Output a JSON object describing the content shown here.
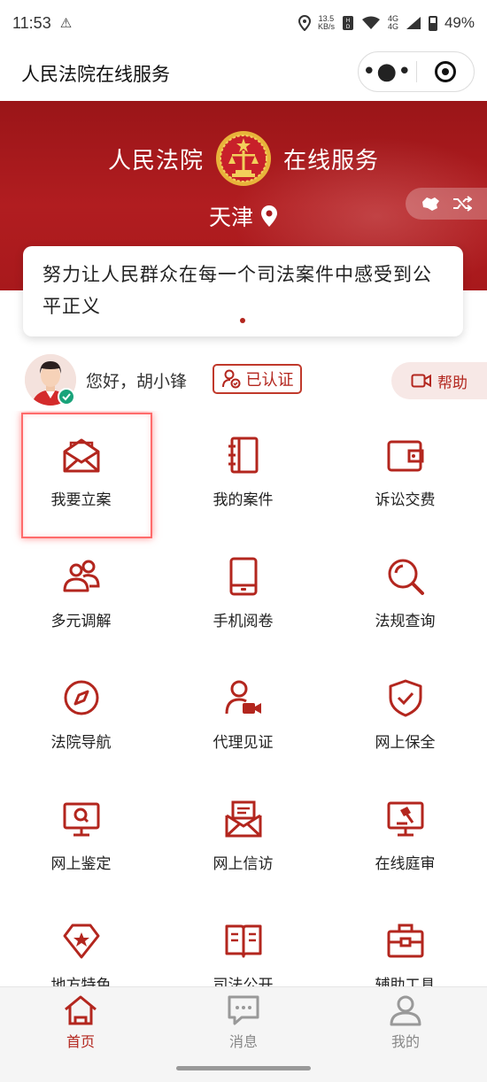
{
  "status_bar": {
    "time": "11:53",
    "net_speed_top": "13.5",
    "net_speed_unit": "KB/s",
    "network": "4G",
    "battery": "49%"
  },
  "title_bar": {
    "title": "人民法院在线服务"
  },
  "banner": {
    "left_text": "人民法院",
    "right_text": "在线服务",
    "city": "天津"
  },
  "slogan": {
    "text": "努力让人民群众在每一个司法案件中感受到公平正义"
  },
  "user": {
    "greeting": "您好，胡小锋",
    "verified_label": "已认证",
    "help_label": "帮助"
  },
  "grid": {
    "items": [
      {
        "label": "我要立案",
        "icon": "envelope-open-icon"
      },
      {
        "label": "我的案件",
        "icon": "notebook-icon"
      },
      {
        "label": "诉讼交费",
        "icon": "wallet-icon"
      },
      {
        "label": "多元调解",
        "icon": "people-icon"
      },
      {
        "label": "手机阅卷",
        "icon": "mobile-phone-icon"
      },
      {
        "label": "法规查询",
        "icon": "search-icon"
      },
      {
        "label": "法院导航",
        "icon": "compass-icon"
      },
      {
        "label": "代理见证",
        "icon": "user-video-icon"
      },
      {
        "label": "网上保全",
        "icon": "shield-check-icon"
      },
      {
        "label": "网上鉴定",
        "icon": "monitor-search-icon"
      },
      {
        "label": "网上信访",
        "icon": "letter-icon"
      },
      {
        "label": "在线庭审",
        "icon": "gavel-monitor-icon"
      },
      {
        "label": "地方特色",
        "icon": "star-gem-icon"
      },
      {
        "label": "司法公开",
        "icon": "open-book-icon"
      },
      {
        "label": "辅助工具",
        "icon": "toolbox-icon"
      }
    ]
  },
  "tab_bar": {
    "tabs": [
      {
        "label": "首页",
        "icon": "home-icon",
        "active": true
      },
      {
        "label": "消息",
        "icon": "message-icon",
        "active": false
      },
      {
        "label": "我的",
        "icon": "profile-icon",
        "active": false
      }
    ]
  },
  "colors": {
    "brand_red": "#b3261e",
    "banner_red": "#a8191c",
    "highlight": "#ff6b6b"
  }
}
